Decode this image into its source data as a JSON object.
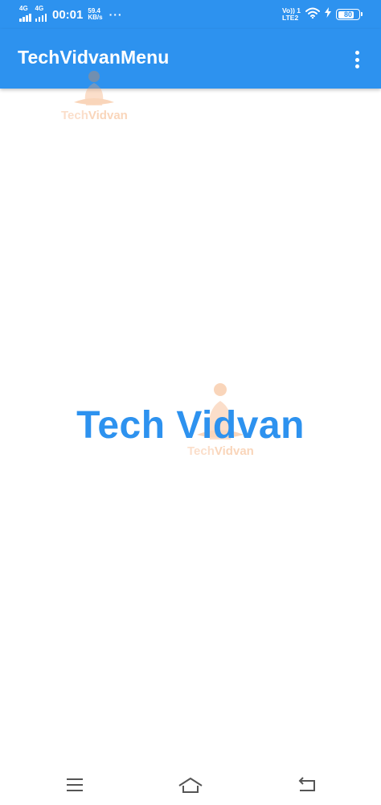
{
  "status_bar": {
    "network_1": "4G",
    "network_2": "4G",
    "time": "00:01",
    "speed_value": "59.4",
    "speed_unit": "KB/s",
    "more": "···",
    "volte_line1": "Vo)) 1",
    "volte_line2": "LTE2",
    "battery": "80",
    "battery_level": 0.8,
    "icons": [
      "signal-icon",
      "signal-icon",
      "wifi-icon",
      "charging-icon",
      "battery-icon"
    ]
  },
  "toolbar": {
    "title": "TechVidvanMenu",
    "overflow_icon": "more-vert-icon"
  },
  "watermark": {
    "text_a": "Tech",
    "text_b": "Vidvan"
  },
  "main": {
    "text": "Tech Vidvan"
  },
  "navbar": {
    "icons": [
      "menu-icon",
      "home-icon",
      "back-icon"
    ]
  },
  "colors": {
    "primary": "#2d92ef",
    "watermark": "#f08a3c",
    "background": "#ffffff"
  }
}
